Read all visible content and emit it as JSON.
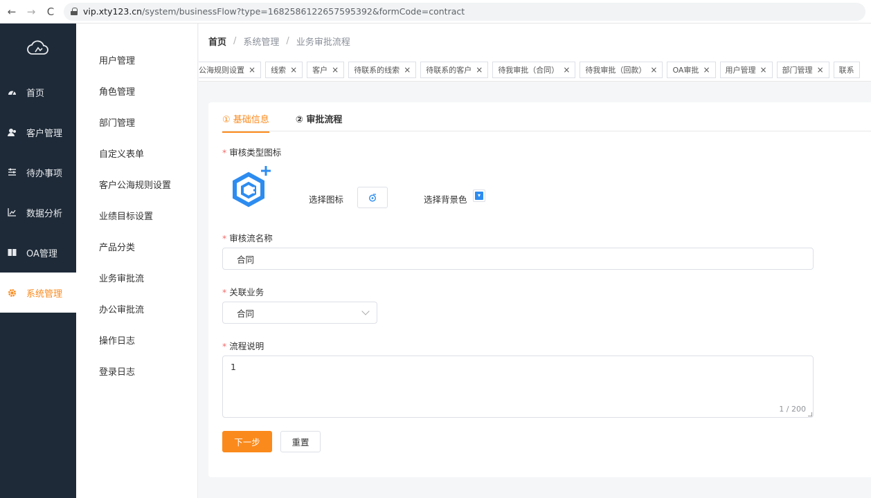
{
  "browser": {
    "url_host": "vip.xty123.cn",
    "url_rest": "/system/businessFlow?type=1682586122657595392&formCode=contract"
  },
  "sidebar": {
    "items": [
      {
        "label": "首页",
        "icon": "dashboard-icon"
      },
      {
        "label": "客户管理",
        "icon": "users-icon"
      },
      {
        "label": "待办事项",
        "icon": "tasks-icon"
      },
      {
        "label": "数据分析",
        "icon": "chart-icon"
      },
      {
        "label": "OA管理",
        "icon": "book-icon"
      },
      {
        "label": "系统管理",
        "icon": "gear-icon",
        "active": true
      }
    ]
  },
  "submenu": {
    "items": [
      "用户管理",
      "角色管理",
      "部门管理",
      "自定义表单",
      "客户公海规则设置",
      "业绩目标设置",
      "产品分类",
      "业务审批流",
      "办公审批流",
      "操作日志",
      "登录日志"
    ]
  },
  "breadcrumb": {
    "home": "首页",
    "sep": "/",
    "level1": "系统管理",
    "level2": "业务审批流程"
  },
  "tabs": [
    "公海规则设置",
    "线索",
    "客户",
    "待联系的线索",
    "待联系的客户",
    "待我审批（合同）",
    "待我审批（回款）",
    "OA审批",
    "用户管理",
    "部门管理",
    "联系"
  ],
  "tab_close": "×",
  "form": {
    "steps": [
      "① 基础信息",
      "② 审批流程"
    ],
    "icon_label": "审核类型图标",
    "pick_icon_label": "选择图标",
    "pick_bg_label": "选择背景色",
    "name_label": "审核流名称",
    "name_value": "合同",
    "business_label": "关联业务",
    "business_value": "合同",
    "desc_label": "流程说明",
    "desc_value": "1",
    "desc_counter": "1 / 200",
    "next_button": "下一步",
    "reset_button": "重置",
    "required_mark": "*"
  },
  "colors": {
    "sidebar_bg": "#1e2a38",
    "accent": "#fb8a1c",
    "icon_blue": "#2d8cf0"
  }
}
